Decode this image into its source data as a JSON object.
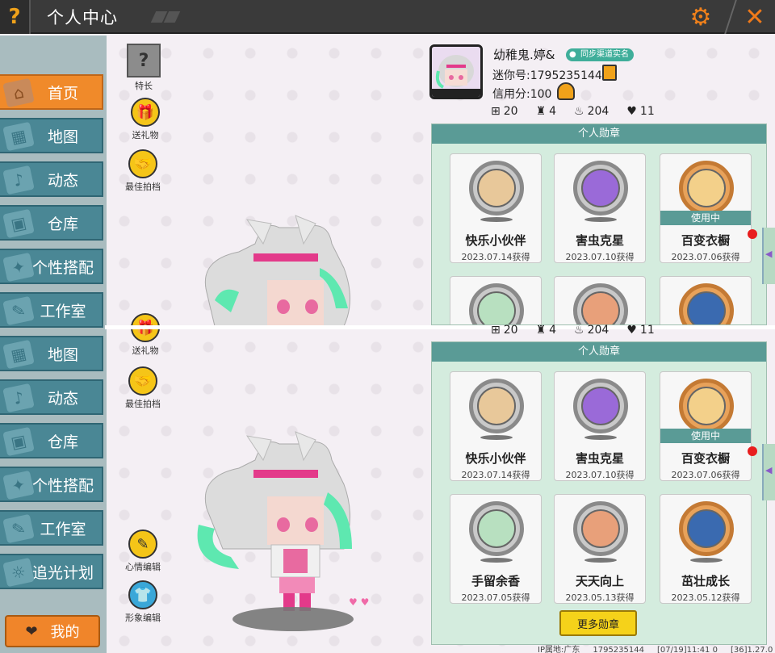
{
  "titlebar": {
    "title": "个人中心",
    "help_icon": "?",
    "gear_icon": "gear-icon",
    "close_icon": "✕"
  },
  "sidebar": {
    "items": [
      {
        "label": "首页",
        "icon": "home-icon",
        "active": true
      },
      {
        "label": "地图",
        "icon": "map-icon"
      },
      {
        "label": "动态",
        "icon": "bell-icon"
      },
      {
        "label": "仓库",
        "icon": "warehouse-icon"
      },
      {
        "label": "个性搭配",
        "icon": "outfit-icon"
      },
      {
        "label": "工作室",
        "icon": "studio-icon"
      },
      {
        "label": "地图",
        "icon": "map-icon"
      },
      {
        "label": "动态",
        "icon": "bell-icon"
      },
      {
        "label": "仓库",
        "icon": "warehouse-icon"
      },
      {
        "label": "个性搭配",
        "icon": "outfit-icon"
      },
      {
        "label": "工作室",
        "icon": "studio-icon"
      },
      {
        "label": "追光计划",
        "icon": "light-icon"
      }
    ],
    "mine_label": "我的"
  },
  "actions": {
    "specialty": "特长",
    "send_gift": "送礼物",
    "best_partner": "最佳拍档",
    "send_gift_2": "送礼物",
    "best_partner_2": "最佳拍档",
    "mood_edit": "心情编辑",
    "image_edit": "形象编辑"
  },
  "profile": {
    "name": "幼稚鬼.婷&",
    "realname_tag": "同步渠道实名",
    "mini_id": "迷你号:1795235144",
    "credit": "信用分:100",
    "stats": [
      {
        "icon": "plus-icon",
        "value": "20"
      },
      {
        "icon": "fans-icon",
        "value": "4"
      },
      {
        "icon": "fire-icon",
        "value": "204"
      },
      {
        "icon": "heart-icon",
        "value": "11"
      }
    ]
  },
  "badges_panel": {
    "title": "个人勋章",
    "using_label": "使用中",
    "badges": [
      {
        "name": "快乐小伙伴",
        "date": "2023.07.14获得",
        "style": "silver"
      },
      {
        "name": "害虫克星",
        "date": "2023.07.10获得",
        "style": "silver"
      },
      {
        "name": "百变衣橱",
        "date": "2023.07.06获得",
        "style": "bronze",
        "in_use": true
      },
      {
        "name": "手留余香",
        "date": "2023.07.05获得",
        "style": "silver"
      },
      {
        "name": "天天向上",
        "date": "2023.05.13获得",
        "style": "silver"
      },
      {
        "name": "茁壮成长",
        "date": "2023.05.12获得",
        "style": "bronze"
      }
    ],
    "more_label": "更多勋章"
  },
  "footer": {
    "ip": "IP属地:广东",
    "uid": "1795235144",
    "time": "[07/19]11:41 0",
    "version": "[36]1.27.0"
  },
  "colors": {
    "accent": "#f08a2a",
    "nav": "#4a8795",
    "panel_head": "#5a9b96"
  }
}
